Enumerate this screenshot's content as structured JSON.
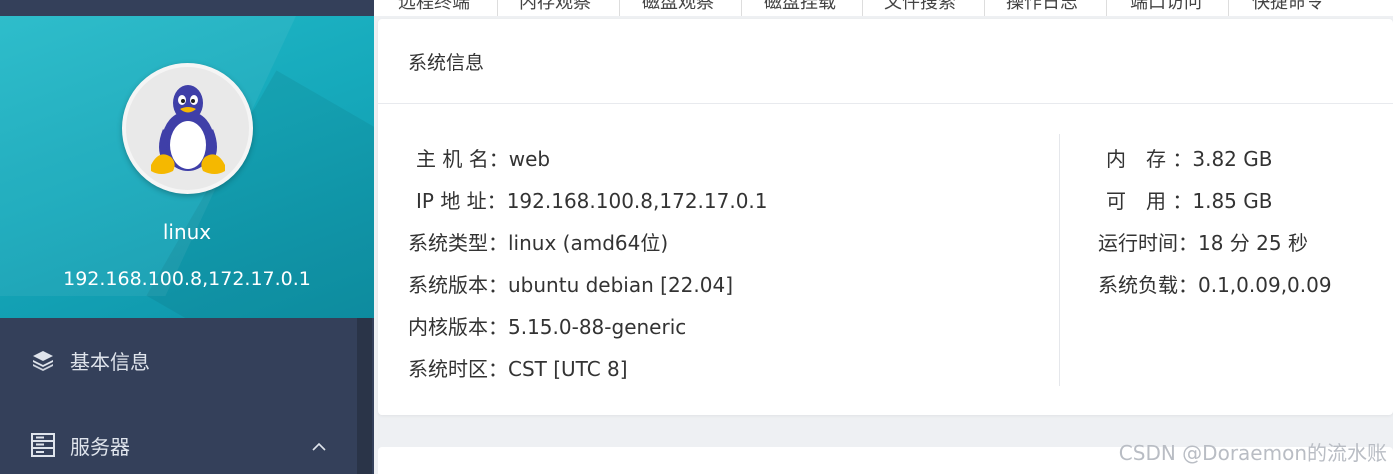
{
  "top_tabs": [
    "远程终端",
    "内存观察",
    "磁盘观察",
    "磁盘挂载",
    "文件搜索",
    "操作日志",
    "端口访问",
    "快捷命令"
  ],
  "profile": {
    "os_icon": "linux-tux-icon",
    "name": "linux",
    "ip": "192.168.100.8,172.17.0.1"
  },
  "nav": {
    "basic_info": {
      "label": "基本信息",
      "icon": "layers-icon"
    },
    "server": {
      "label": "服务器",
      "icon": "server-icon",
      "chevron": "chevron-up-icon"
    }
  },
  "system_info": {
    "title": "系统信息",
    "left": [
      {
        "label": "主 机 名：",
        "value": "web"
      },
      {
        "label": "IP 地 址：",
        "value": "192.168.100.8,172.17.0.1"
      },
      {
        "label": "系统类型：",
        "value": "linux (amd64位)"
      },
      {
        "label": "系统版本：",
        "value": "ubuntu debian [22.04]"
      },
      {
        "label": "内核版本：",
        "value": "5.15.0-88-generic"
      },
      {
        "label": "系统时区：",
        "value": "CST [UTC 8]"
      }
    ],
    "right": [
      {
        "label": "内　存 ：",
        "value": "3.82 GB"
      },
      {
        "label": "可　用 ：",
        "value": "1.85 GB"
      },
      {
        "label": "运行时间：",
        "value": "18 分 25 秒"
      },
      {
        "label": "系统负载：",
        "value": "0.1,0.09,0.09"
      }
    ]
  },
  "watermark": "CSDN @Doraemon的流水账",
  "colors": {
    "sidebar": "#34405a",
    "profile_gradient": "#16a9bb",
    "accent_text": "#ffffff"
  }
}
